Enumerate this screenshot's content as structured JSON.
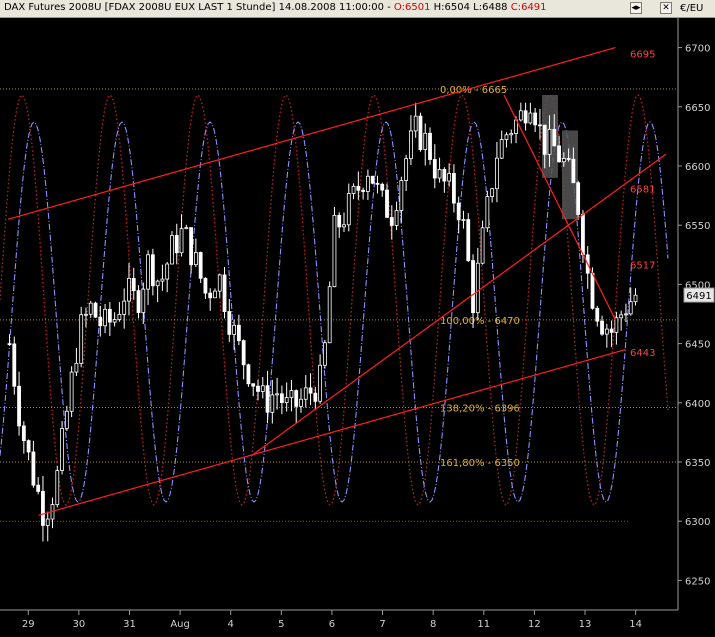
{
  "window": {
    "title_parts": [
      "DAX Futures 2008U [FDAX 2008U EUX LAST 1 Stunde]",
      "14.08.2008 11:00:00 -",
      "O:6501",
      "H:6504",
      "L:6488",
      "C:6491"
    ],
    "currency": "€/EU",
    "buttons": [
      "◂▸",
      "✕"
    ]
  },
  "chart_data": {
    "type": "candlestick",
    "title": "DAX Futures 2008U [FDAX 2008U EUX LAST 1 Stunde] 14.08.2008 11:00:00",
    "ohlc_last": {
      "open": 6501,
      "high": 6504,
      "low": 6488,
      "close": 6491
    },
    "y_unit": "€/EU",
    "ylim": [
      6225,
      6725
    ],
    "y_ticks": [
      6250,
      6300,
      6350,
      6400,
      6450,
      6500,
      6550,
      6600,
      6650,
      6700
    ],
    "x_ticks": [
      "29",
      "30",
      "31",
      "Aug",
      "4",
      "5",
      "6",
      "7",
      "8",
      "11",
      "12",
      "13",
      "14"
    ],
    "last_price_label": "6491",
    "price_path": [
      [
        0,
        6450
      ],
      [
        1,
        6380
      ],
      [
        2,
        6340
      ],
      [
        3,
        6305
      ],
      [
        4,
        6330
      ],
      [
        5,
        6395
      ],
      [
        6,
        6460
      ],
      [
        7,
        6480
      ],
      [
        8,
        6465
      ],
      [
        9,
        6470
      ],
      [
        10,
        6495
      ],
      [
        11,
        6485
      ],
      [
        12,
        6520
      ],
      [
        13,
        6500
      ],
      [
        14,
        6530
      ],
      [
        15,
        6545
      ],
      [
        16,
        6520
      ],
      [
        17,
        6490
      ],
      [
        18,
        6510
      ],
      [
        19,
        6470
      ],
      [
        20,
        6440
      ],
      [
        21,
        6420
      ],
      [
        22,
        6400
      ],
      [
        23,
        6410
      ],
      [
        24,
        6395
      ],
      [
        25,
        6400
      ],
      [
        26,
        6410
      ],
      [
        27,
        6420
      ],
      [
        28,
        6545
      ],
      [
        29,
        6560
      ],
      [
        30,
        6580
      ],
      [
        31,
        6600
      ],
      [
        32,
        6570
      ],
      [
        33,
        6560
      ],
      [
        34,
        6600
      ],
      [
        35,
        6630
      ],
      [
        36,
        6620
      ],
      [
        37,
        6590
      ],
      [
        38,
        6580
      ],
      [
        39,
        6560
      ],
      [
        40,
        6485
      ],
      [
        41,
        6550
      ],
      [
        42,
        6610
      ],
      [
        43,
        6630
      ],
      [
        44,
        6640
      ],
      [
        45,
        6660
      ],
      [
        46,
        6620
      ],
      [
        47,
        6615
      ],
      [
        48,
        6600
      ],
      [
        49,
        6570
      ],
      [
        50,
        6500
      ],
      [
        51,
        6470
      ],
      [
        52,
        6460
      ],
      [
        53,
        6480
      ],
      [
        54,
        6491
      ]
    ],
    "fibonacci_levels": [
      {
        "label": "0,00% - 6665",
        "value": 6665
      },
      {
        "label": "100,00% - 6470",
        "value": 6470
      },
      {
        "label": "138,20% - 6396",
        "value": 6396
      },
      {
        "label": "161,80% - 6350",
        "value": 6350
      }
    ],
    "support_line": {
      "label": "6300",
      "value": 6300
    },
    "trendline_labels": [
      {
        "label": "6695",
        "value": 6695
      },
      {
        "label": "6581",
        "value": 6581
      },
      {
        "label": "6517",
        "value": 6517
      },
      {
        "label": "6443",
        "value": 6443
      }
    ],
    "trendlines": [
      {
        "name": "upper-channel",
        "from": [
          0,
          6555
        ],
        "to": [
          60,
          6700
        ]
      },
      {
        "name": "lower-channel",
        "from": [
          3,
          6305
        ],
        "to": [
          61,
          6445
        ]
      },
      {
        "name": "inner-uptrend",
        "from": [
          24,
          6355
        ],
        "to": [
          65,
          6610
        ]
      },
      {
        "name": "downtrend",
        "from": [
          49,
          6660
        ],
        "to": [
          60,
          6470
        ]
      }
    ],
    "colors": {
      "background": "#000000",
      "candles": "#ffffff",
      "fib": "#e0b030",
      "trend": "#ff2020",
      "osc_fast": "#c0202a",
      "osc_slow": "#8f8fff",
      "highlight": "#555555"
    },
    "grid": false
  }
}
